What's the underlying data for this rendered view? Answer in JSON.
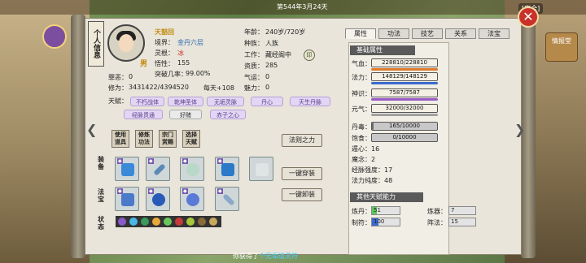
{
  "topbar": {
    "date": "第544年3月24天",
    "safe": "[安全]"
  },
  "right_side": {
    "label": "情报堂"
  },
  "title_tag": "个人信息",
  "profile": {
    "name": "天豁回",
    "gender": "男",
    "realm_label": "境界：",
    "realm_value": "金丹六层",
    "root_label": "灵根：",
    "root_value": "冰",
    "xing_label": "悟性：",
    "xing_value": "155",
    "break_label": "突破几率：",
    "break_value": "99.00%",
    "cult_label": "修为：",
    "cult_value": "3431422/4394520",
    "per_day": "每天+108",
    "rep_label": "罪恶：",
    "rep_value": "0",
    "xin_label": "心念：",
    "xin_value": "0"
  },
  "right_info": {
    "age_label": "年龄：",
    "age_value": "240岁/720岁",
    "race_label": "种族：",
    "race_value": "人族",
    "work_label": "工作：",
    "work_value": "藏经阁中",
    "seal": "印",
    "zizhi_label": "资质：",
    "zizhi_value": "285",
    "qiyun_label": "气运：",
    "qiyun_value": "0",
    "meili_label": "魅力：",
    "meili_value": "0"
  },
  "talents": {
    "label": "天赋：",
    "items": [
      "不朽战体",
      "乾坤圣体",
      "无垢灵脉",
      "丹心",
      "天生丹脉",
      "经脉贯通",
      "好赌",
      "赤子之心"
    ]
  },
  "actions": [
    "使用道具",
    "修炼功法",
    "宗门赏赐",
    "选择天赋"
  ],
  "sidelabels": {
    "equip": "装备",
    "gear": "法宝",
    "status": "状态"
  },
  "buttons": {
    "fa_ze": "法则之力",
    "wear_all": "一键穿装",
    "remove_all": "一键卸装"
  },
  "tabs": [
    "属性",
    "功法",
    "技艺",
    "关系",
    "法宝"
  ],
  "attrs": {
    "title": "基础属性",
    "qixue_label": "气血：",
    "qixue": "228810/228810",
    "fali_label": "法力：",
    "fali": "148129/148129",
    "shenshi_label": "神识：",
    "shenshi": "7587/7587",
    "yuanqi_label": "元气：",
    "yuanqi": "32000/32000",
    "danjin_label": "丹毒：",
    "danjin": "165/10000",
    "baoshi_label": "饱食：",
    "baoshi": "0/10000",
    "dunxin": "遁心：16",
    "moli": "魔念：2",
    "jingmai": "经脉强度：17",
    "falichun": "法力纯度：48",
    "other_title": "其他天赋能力",
    "liandan_label": "炼丹：",
    "liandan": "51",
    "lianqi_label": "炼器：",
    "lianqi": "7",
    "zhifu_label": "制符：",
    "zhifu": "100",
    "zhenfa_label": "阵法：",
    "zhenfa": "15"
  },
  "chat": {
    "prefix": "你获得了",
    "item": "个无垢道灵符"
  },
  "colors": {
    "hp": "#e07a2a",
    "mp": "#3a6ad0",
    "shen": "#9a5ac8",
    "yuan": "#a0a0a0"
  }
}
